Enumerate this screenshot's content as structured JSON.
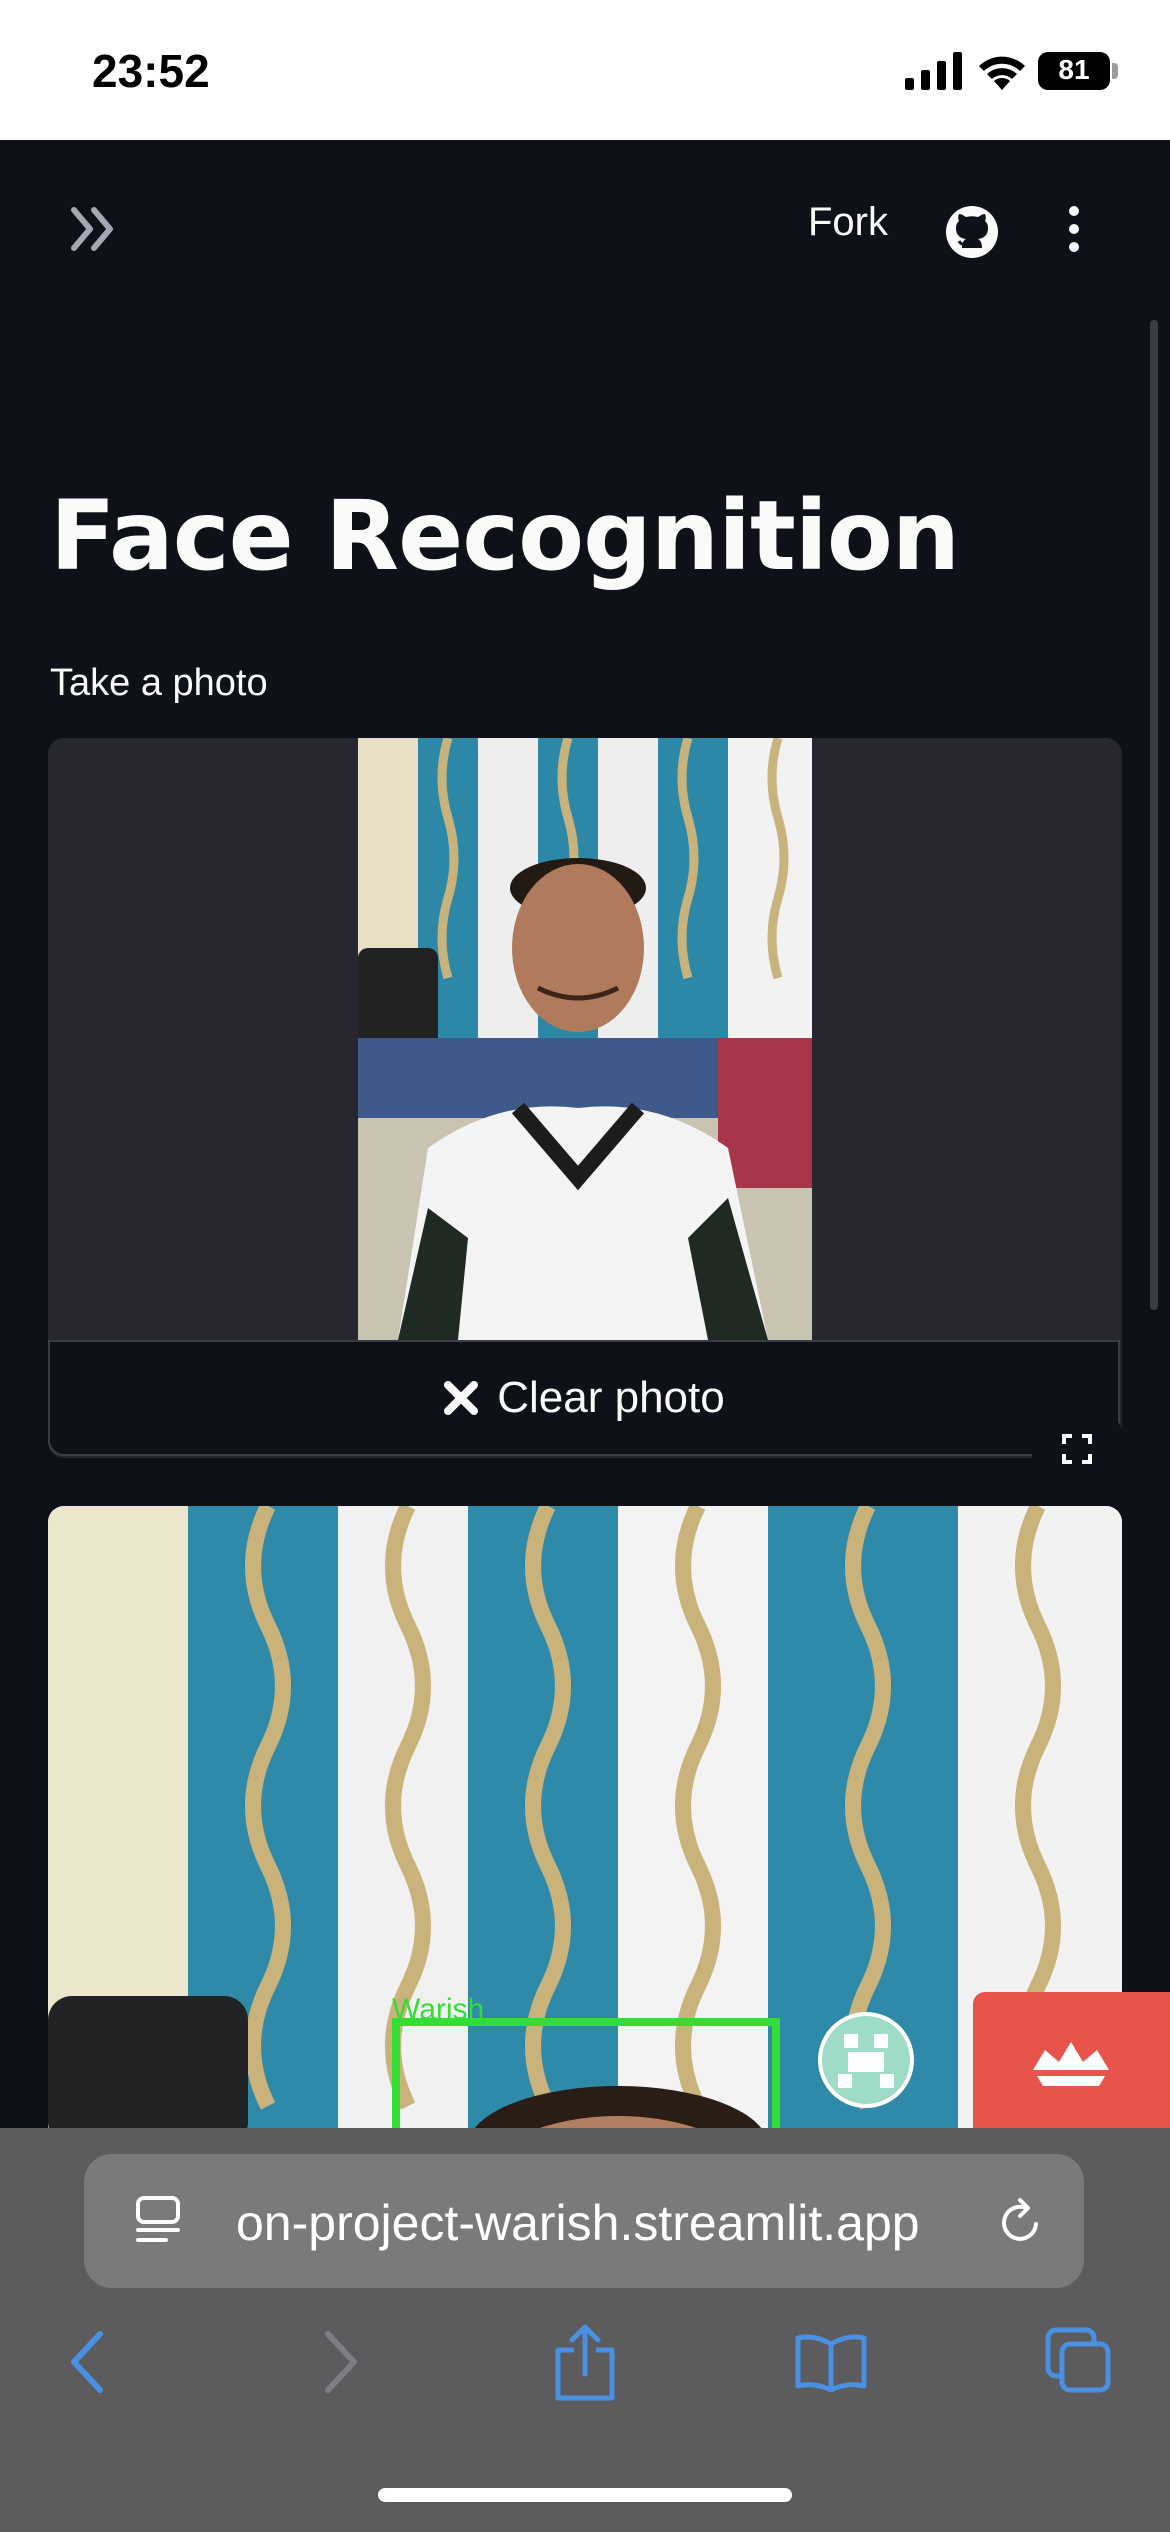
{
  "status_bar": {
    "time": "23:52",
    "battery": "81"
  },
  "app_header": {
    "fork_label": "Fork"
  },
  "main": {
    "title": "Face Recognition",
    "camera_label": "Take a photo",
    "clear_button_label": "Clear photo",
    "detection_label": "Warish"
  },
  "browser": {
    "url": "on-project-warish.streamlit.app"
  },
  "colors": {
    "background": "#0e1117",
    "accent": "#4a90e2",
    "badge": "#e8544c",
    "box": "#33dd33"
  }
}
